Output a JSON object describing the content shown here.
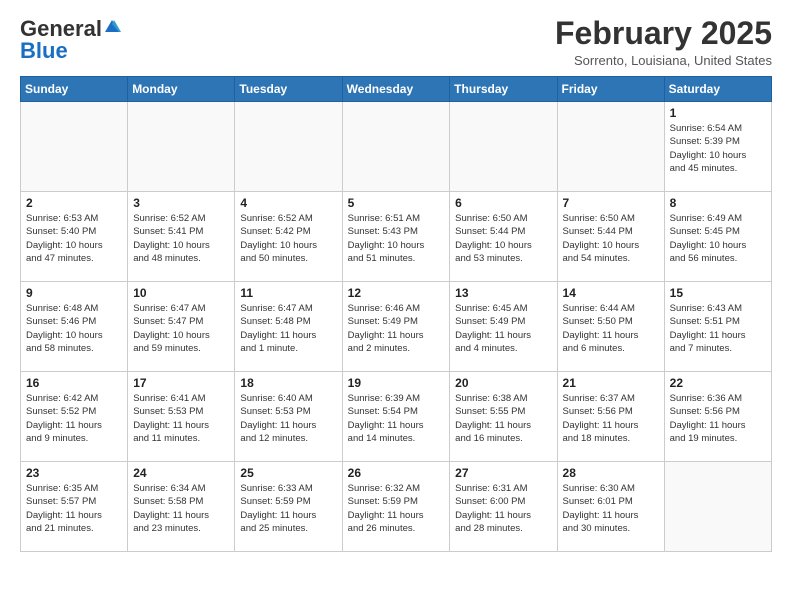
{
  "header": {
    "logo_general": "General",
    "logo_blue": "Blue",
    "month": "February 2025",
    "location": "Sorrento, Louisiana, United States"
  },
  "weekdays": [
    "Sunday",
    "Monday",
    "Tuesday",
    "Wednesday",
    "Thursday",
    "Friday",
    "Saturday"
  ],
  "weeks": [
    [
      {
        "day": "",
        "info": ""
      },
      {
        "day": "",
        "info": ""
      },
      {
        "day": "",
        "info": ""
      },
      {
        "day": "",
        "info": ""
      },
      {
        "day": "",
        "info": ""
      },
      {
        "day": "",
        "info": ""
      },
      {
        "day": "1",
        "info": "Sunrise: 6:54 AM\nSunset: 5:39 PM\nDaylight: 10 hours\nand 45 minutes."
      }
    ],
    [
      {
        "day": "2",
        "info": "Sunrise: 6:53 AM\nSunset: 5:40 PM\nDaylight: 10 hours\nand 47 minutes."
      },
      {
        "day": "3",
        "info": "Sunrise: 6:52 AM\nSunset: 5:41 PM\nDaylight: 10 hours\nand 48 minutes."
      },
      {
        "day": "4",
        "info": "Sunrise: 6:52 AM\nSunset: 5:42 PM\nDaylight: 10 hours\nand 50 minutes."
      },
      {
        "day": "5",
        "info": "Sunrise: 6:51 AM\nSunset: 5:43 PM\nDaylight: 10 hours\nand 51 minutes."
      },
      {
        "day": "6",
        "info": "Sunrise: 6:50 AM\nSunset: 5:44 PM\nDaylight: 10 hours\nand 53 minutes."
      },
      {
        "day": "7",
        "info": "Sunrise: 6:50 AM\nSunset: 5:44 PM\nDaylight: 10 hours\nand 54 minutes."
      },
      {
        "day": "8",
        "info": "Sunrise: 6:49 AM\nSunset: 5:45 PM\nDaylight: 10 hours\nand 56 minutes."
      }
    ],
    [
      {
        "day": "9",
        "info": "Sunrise: 6:48 AM\nSunset: 5:46 PM\nDaylight: 10 hours\nand 58 minutes."
      },
      {
        "day": "10",
        "info": "Sunrise: 6:47 AM\nSunset: 5:47 PM\nDaylight: 10 hours\nand 59 minutes."
      },
      {
        "day": "11",
        "info": "Sunrise: 6:47 AM\nSunset: 5:48 PM\nDaylight: 11 hours\nand 1 minute."
      },
      {
        "day": "12",
        "info": "Sunrise: 6:46 AM\nSunset: 5:49 PM\nDaylight: 11 hours\nand 2 minutes."
      },
      {
        "day": "13",
        "info": "Sunrise: 6:45 AM\nSunset: 5:49 PM\nDaylight: 11 hours\nand 4 minutes."
      },
      {
        "day": "14",
        "info": "Sunrise: 6:44 AM\nSunset: 5:50 PM\nDaylight: 11 hours\nand 6 minutes."
      },
      {
        "day": "15",
        "info": "Sunrise: 6:43 AM\nSunset: 5:51 PM\nDaylight: 11 hours\nand 7 minutes."
      }
    ],
    [
      {
        "day": "16",
        "info": "Sunrise: 6:42 AM\nSunset: 5:52 PM\nDaylight: 11 hours\nand 9 minutes."
      },
      {
        "day": "17",
        "info": "Sunrise: 6:41 AM\nSunset: 5:53 PM\nDaylight: 11 hours\nand 11 minutes."
      },
      {
        "day": "18",
        "info": "Sunrise: 6:40 AM\nSunset: 5:53 PM\nDaylight: 11 hours\nand 12 minutes."
      },
      {
        "day": "19",
        "info": "Sunrise: 6:39 AM\nSunset: 5:54 PM\nDaylight: 11 hours\nand 14 minutes."
      },
      {
        "day": "20",
        "info": "Sunrise: 6:38 AM\nSunset: 5:55 PM\nDaylight: 11 hours\nand 16 minutes."
      },
      {
        "day": "21",
        "info": "Sunrise: 6:37 AM\nSunset: 5:56 PM\nDaylight: 11 hours\nand 18 minutes."
      },
      {
        "day": "22",
        "info": "Sunrise: 6:36 AM\nSunset: 5:56 PM\nDaylight: 11 hours\nand 19 minutes."
      }
    ],
    [
      {
        "day": "23",
        "info": "Sunrise: 6:35 AM\nSunset: 5:57 PM\nDaylight: 11 hours\nand 21 minutes."
      },
      {
        "day": "24",
        "info": "Sunrise: 6:34 AM\nSunset: 5:58 PM\nDaylight: 11 hours\nand 23 minutes."
      },
      {
        "day": "25",
        "info": "Sunrise: 6:33 AM\nSunset: 5:59 PM\nDaylight: 11 hours\nand 25 minutes."
      },
      {
        "day": "26",
        "info": "Sunrise: 6:32 AM\nSunset: 5:59 PM\nDaylight: 11 hours\nand 26 minutes."
      },
      {
        "day": "27",
        "info": "Sunrise: 6:31 AM\nSunset: 6:00 PM\nDaylight: 11 hours\nand 28 minutes."
      },
      {
        "day": "28",
        "info": "Sunrise: 6:30 AM\nSunset: 6:01 PM\nDaylight: 11 hours\nand 30 minutes."
      },
      {
        "day": "",
        "info": ""
      }
    ]
  ]
}
